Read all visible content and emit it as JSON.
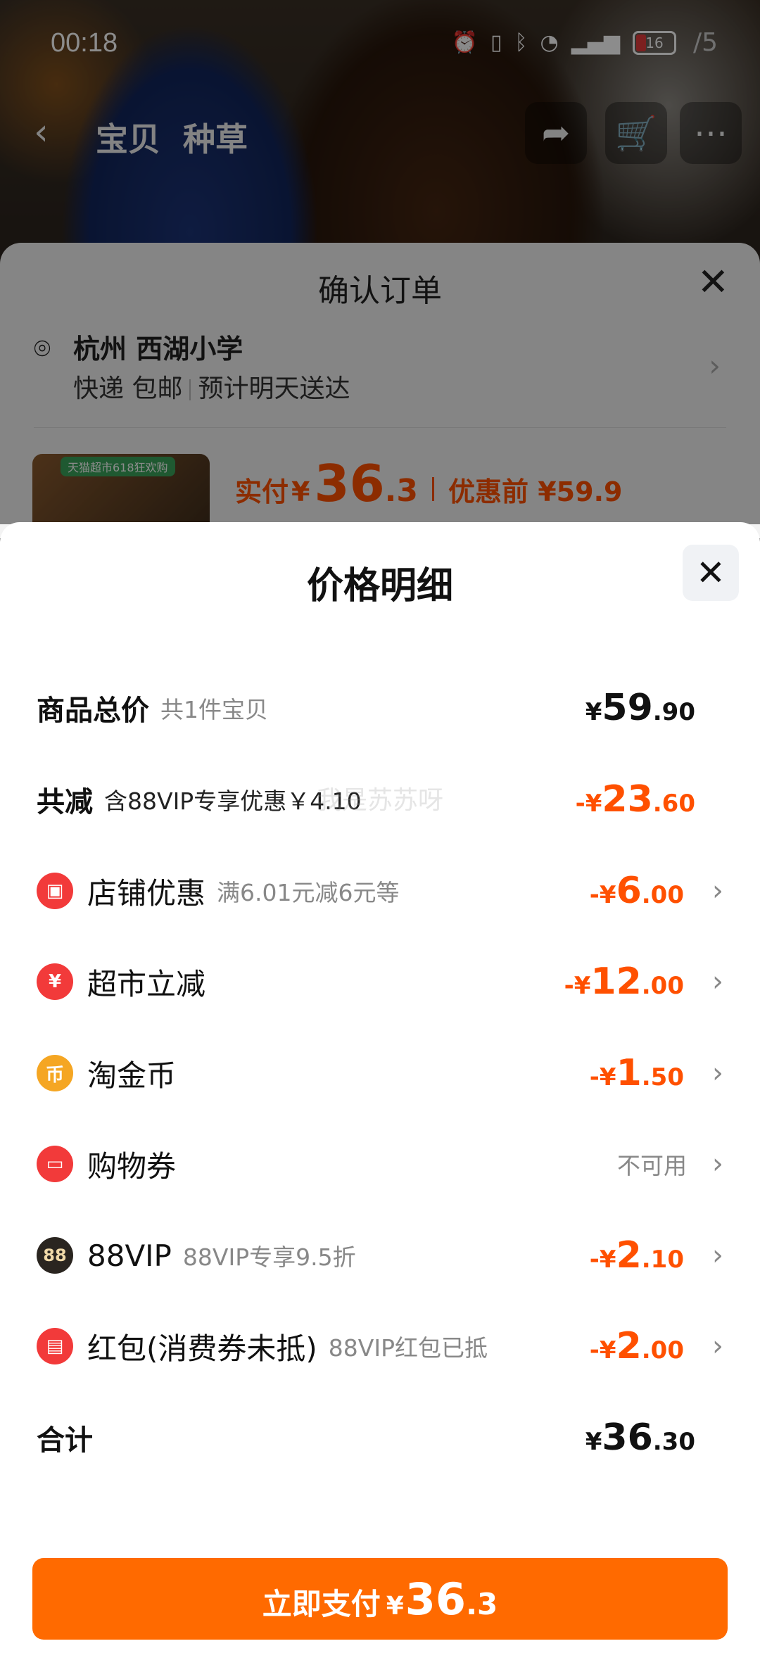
{
  "status_bar": {
    "time": "00:18",
    "battery": "16",
    "page_counter": "/5"
  },
  "top_nav": {
    "tabs": [
      "宝贝",
      "种草"
    ]
  },
  "order_sheet": {
    "title": "确认订单",
    "address": {
      "name": "杭州 西湖小学",
      "delivery": "快递 包邮",
      "eta": "预计明天送达"
    },
    "thumb_tag": "天猫超市618狂欢购",
    "pay_label": "实付",
    "pay_symbol": "¥",
    "pay_int": "36",
    "pay_dec": ".3",
    "pre_discount": "优惠前 ¥59.9"
  },
  "detail": {
    "title": "价格明细",
    "rows": [
      {
        "label": "商品总价",
        "sub": "共1件宝贝",
        "sym": "¥",
        "int": "59",
        "dec": ".90"
      },
      {
        "label": "共减",
        "sub": "含88VIP专享优惠￥4.10",
        "sym": "-¥",
        "int": "23",
        "dec": ".60"
      },
      {
        "label": "店铺优惠",
        "sub": "满6.01元减6元等",
        "sym": "-¥",
        "int": "6",
        "dec": ".00"
      },
      {
        "label": "超市立减",
        "sub": "",
        "sym": "-¥",
        "int": "12",
        "dec": ".00"
      },
      {
        "label": "淘金币",
        "sub": "",
        "sym": "-¥",
        "int": "1",
        "dec": ".50"
      },
      {
        "label": "购物券",
        "sub": "",
        "status": "不可用"
      },
      {
        "label": "88VIP",
        "sub": "88VIP专享9.5折",
        "sym": "-¥",
        "int": "2",
        "dec": ".10"
      },
      {
        "label": "红包(消费券未抵)",
        "sub": "88VIP红包已抵",
        "sym": "-¥",
        "int": "2",
        "dec": ".00"
      },
      {
        "label": "合计",
        "sub": "",
        "sym": "¥",
        "int": "36",
        "dec": ".30"
      }
    ],
    "watermark": "我是苏苏呀"
  },
  "pay_button": {
    "label": "立即支付",
    "sym": "¥",
    "int": "36",
    "dec": ".3"
  },
  "colors": {
    "accent": "#ff5000",
    "button": "#ff6a00"
  }
}
